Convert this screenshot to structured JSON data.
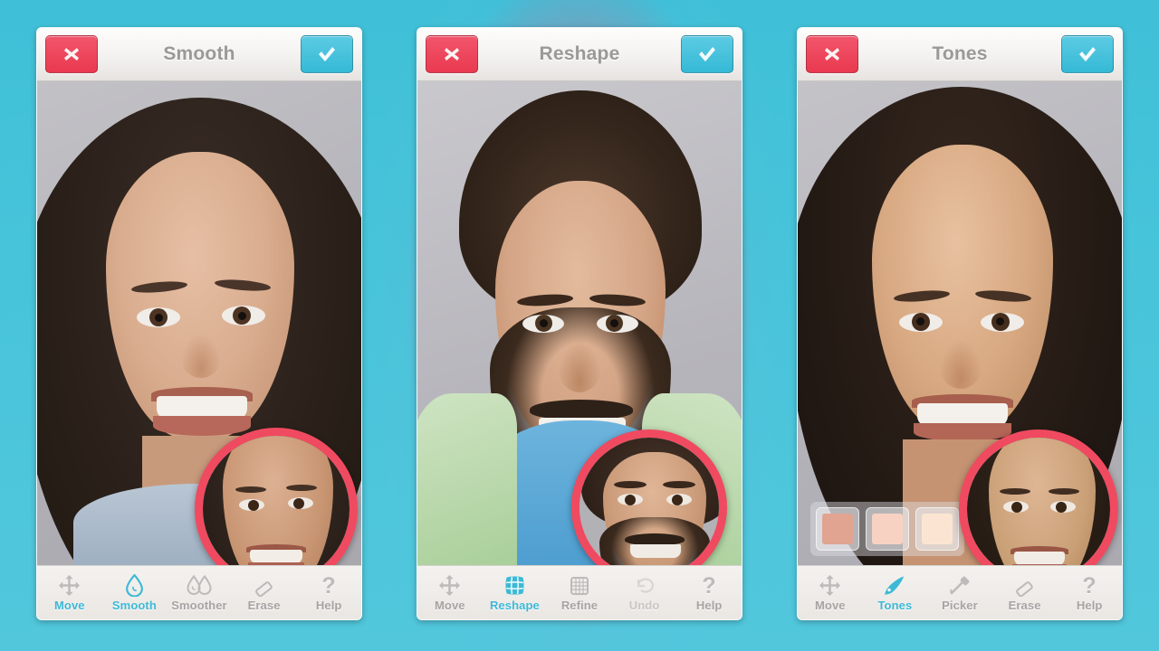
{
  "app": {
    "background_color": "#4ec3d9",
    "accent_color": "#3db9d7",
    "cancel_color": "#e9394f",
    "loupe_ring_color": "#f04a60"
  },
  "panels": [
    {
      "id": "smooth",
      "header": {
        "title": "Smooth",
        "cancel_icon": "close-x-icon",
        "cancel_label": "Cancel",
        "confirm_icon": "checkmark-icon",
        "confirm_label": "Done"
      },
      "photo": {
        "subject": "woman-portrait-retouched",
        "loupe": {
          "visible": true,
          "icon": "magnifier-loupe",
          "content": "woman-portrait-original"
        }
      },
      "swatches": [],
      "toolbar": [
        {
          "label": "Move",
          "icon": "move-arrows-icon",
          "state": "normal"
        },
        {
          "label": "Smooth",
          "icon": "water-drop-icon",
          "state": "active"
        },
        {
          "label": "Smoother",
          "icon": "double-water-drop-icon",
          "state": "normal"
        },
        {
          "label": "Erase",
          "icon": "eraser-icon",
          "state": "normal"
        },
        {
          "label": "Help",
          "icon": "question-mark-icon",
          "state": "normal"
        }
      ]
    },
    {
      "id": "reshape",
      "header": {
        "title": "Reshape",
        "cancel_icon": "close-x-icon",
        "cancel_label": "Cancel",
        "confirm_icon": "checkmark-icon",
        "confirm_label": "Done"
      },
      "photo": {
        "subject": "man-portrait-reshaped",
        "loupe": {
          "visible": true,
          "icon": "magnifier-loupe",
          "content": "man-portrait-original"
        }
      },
      "swatches": [],
      "toolbar": [
        {
          "label": "Move",
          "icon": "move-arrows-icon",
          "state": "normal"
        },
        {
          "label": "Reshape",
          "icon": "warp-grid-icon",
          "state": "active"
        },
        {
          "label": "Refine",
          "icon": "fine-grid-icon",
          "state": "normal"
        },
        {
          "label": "Undo",
          "icon": "undo-arrow-icon",
          "state": "disabled"
        },
        {
          "label": "Help",
          "icon": "question-mark-icon",
          "state": "normal"
        }
      ]
    },
    {
      "id": "tones",
      "header": {
        "title": "Tones",
        "cancel_icon": "close-x-icon",
        "cancel_label": "Cancel",
        "confirm_icon": "checkmark-icon",
        "confirm_label": "Done"
      },
      "photo": {
        "subject": "woman2-portrait-retouched",
        "loupe": {
          "visible": true,
          "icon": "magnifier-loupe",
          "content": "woman2-portrait-original"
        }
      },
      "swatches": [
        {
          "name": "tone-swatch-1",
          "color": "#e0a490",
          "selected": true
        },
        {
          "name": "tone-swatch-2",
          "color": "#f7d2c2",
          "selected": false
        },
        {
          "name": "tone-swatch-3",
          "color": "#fbe5d2",
          "selected": false
        }
      ],
      "toolbar": [
        {
          "label": "Move",
          "icon": "move-arrows-icon",
          "state": "normal"
        },
        {
          "label": "Tones",
          "icon": "paint-brush-icon",
          "state": "active"
        },
        {
          "label": "Picker",
          "icon": "eyedropper-icon",
          "state": "normal"
        },
        {
          "label": "Erase",
          "icon": "eraser-icon",
          "state": "normal"
        },
        {
          "label": "Help",
          "icon": "question-mark-icon",
          "state": "normal"
        }
      ]
    }
  ]
}
